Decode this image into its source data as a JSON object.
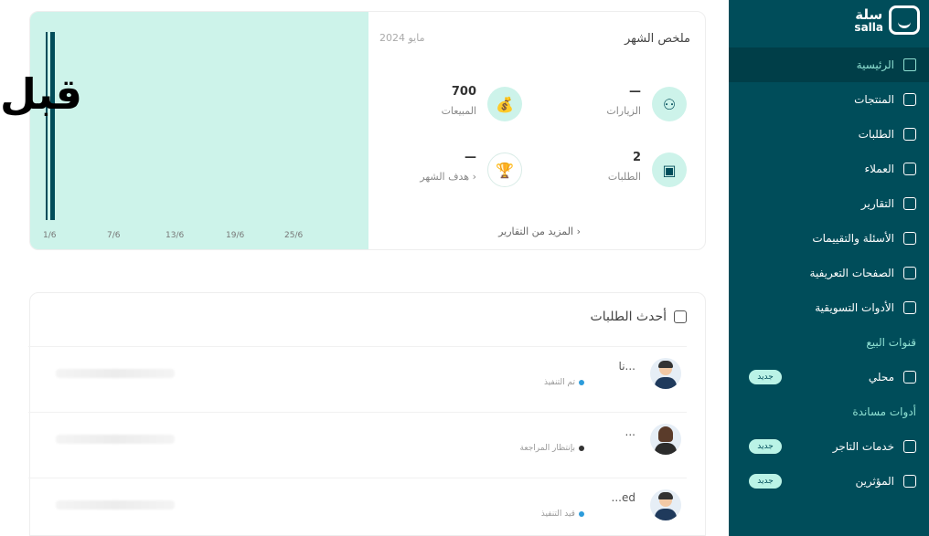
{
  "overlay": {
    "before_label": "قبل"
  },
  "sidebar": {
    "logo": {
      "ar": "سلة",
      "en": "salla",
      "icon": "salla-logo-icon"
    },
    "items": [
      {
        "label": "الرئيسية",
        "icon": "home-icon",
        "active": true
      },
      {
        "label": "المنتجات",
        "icon": "shirt-icon"
      },
      {
        "label": "الطلبات",
        "icon": "box-icon"
      },
      {
        "label": "العملاء",
        "icon": "users-icon"
      },
      {
        "label": "التقارير",
        "icon": "pie-chart-icon"
      },
      {
        "label": "الأسئلة والتقييمات",
        "icon": "chat-icon"
      },
      {
        "label": "الصفحات التعريفية",
        "icon": "page-icon"
      },
      {
        "label": "الأدوات التسويقية",
        "icon": "megaphone-icon"
      }
    ],
    "sales_channels": {
      "title": "قنوات البيع",
      "items": [
        {
          "label": "محلي",
          "icon": "store-icon",
          "badge": "جديد"
        }
      ]
    },
    "support_tools": {
      "title": "أدوات مساندة",
      "items": [
        {
          "label": "خدمات التاجر",
          "icon": "briefcase-icon",
          "badge": "جديد"
        },
        {
          "label": "المؤثرين",
          "icon": "influencer-icon",
          "badge": "جديد"
        }
      ]
    }
  },
  "summary": {
    "title": "ملخص الشهر",
    "date": "مايو 2024",
    "stats": {
      "visits": {
        "value": "—",
        "label": "الزيارات",
        "icon": "users-icon"
      },
      "sales": {
        "value": "700",
        "label": "المبيعات",
        "icon": "money-bag-icon"
      },
      "orders": {
        "value": "2",
        "label": "الطلبات",
        "icon": "box-icon"
      },
      "goal": {
        "value": "—",
        "label": "هدف الشهر ›",
        "icon": "trophy-icon"
      }
    },
    "more_link": "المزيد من التقارير ›"
  },
  "chart_data": {
    "type": "bar",
    "x_ticks": [
      "1/6",
      "7/6",
      "13/6",
      "19/6",
      "25/6"
    ],
    "series": [
      {
        "values": [
          2
        ]
      }
    ],
    "colors": {
      "bar": "#004d5a",
      "background": "#cdf3ea"
    }
  },
  "orders": {
    "title": "أحدث الطلبات",
    "rows": [
      {
        "name": "نا...",
        "status": "تم التنفيذ",
        "status_color": "#2d9cdb",
        "avatar": "male"
      },
      {
        "name": "...",
        "status": "بإنتظار المراجعة",
        "status_color": "#333333",
        "avatar": "female"
      },
      {
        "name": "...ed",
        "status": "قيد التنفيذ",
        "status_color": "#2d9cdb",
        "avatar": "male"
      }
    ]
  },
  "colors": {
    "primary": "#004d5a",
    "accent": "#baf3e6",
    "chart_bg": "#cdf3ea"
  }
}
